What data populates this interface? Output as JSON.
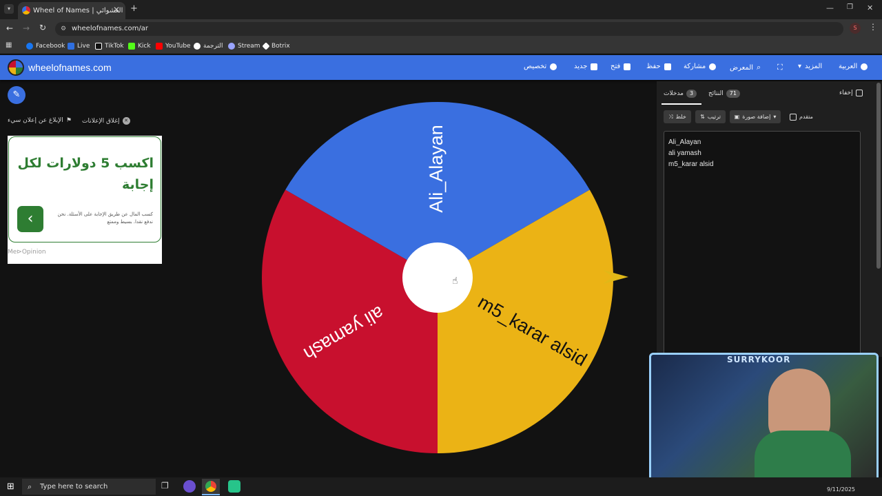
{
  "browser": {
    "tab_title": "Wheel of Names | عجلة الاسم العشوائي",
    "url": "wheelofnames.com/ar",
    "profile_initial": "S",
    "bookmarks": [
      "Facebook",
      "Live",
      "TikTok",
      "Kick",
      "YouTube",
      "الترجمة",
      "Stream",
      "Botrix"
    ]
  },
  "header": {
    "logo": "wheelofnames.com",
    "nav": {
      "customize": "تخصيص",
      "new": "جديد",
      "open": "فتح",
      "save": "حفظ",
      "share": "مشاركة",
      "gallery": "المعرض",
      "more": "المزيد",
      "language": "العربية"
    }
  },
  "ads": {
    "close_ads": "إغلاق الإعلانات",
    "report_ad": "الإبلاغ عن إعلان سيء",
    "headline": "اكسب 5 دولارات لكل إجابة",
    "body": "كسب المال عن طريق الإجابة على الأسئلة. نحن ندفع نقدا. بسيط وممتع",
    "brand": "Me⊳Opinion"
  },
  "wheel": {
    "slices": [
      {
        "label": "Ali_Alayan",
        "color": "#3a6fe0"
      },
      {
        "label": "m5_karar alsid",
        "color": "#ebb315"
      },
      {
        "label": "ali yamash",
        "color": "#c8102e"
      }
    ]
  },
  "panel": {
    "hide_label": "إخفاء",
    "results_tab": "النتائج",
    "results_count": "71",
    "entries_tab": "مدخلات",
    "entries_count": "3",
    "shuffle": "خلط",
    "sort": "ترتيب",
    "add_image": "إضافة صورة",
    "advanced": "متقدم",
    "entries": [
      "Ali_Alayan",
      "ali yamash",
      "m5_karar alsid"
    ]
  },
  "webcam": {
    "overlay_text": "SURRYKOOR"
  },
  "taskbar": {
    "search_placeholder": "Type here to search",
    "date": "9/11/2025"
  }
}
